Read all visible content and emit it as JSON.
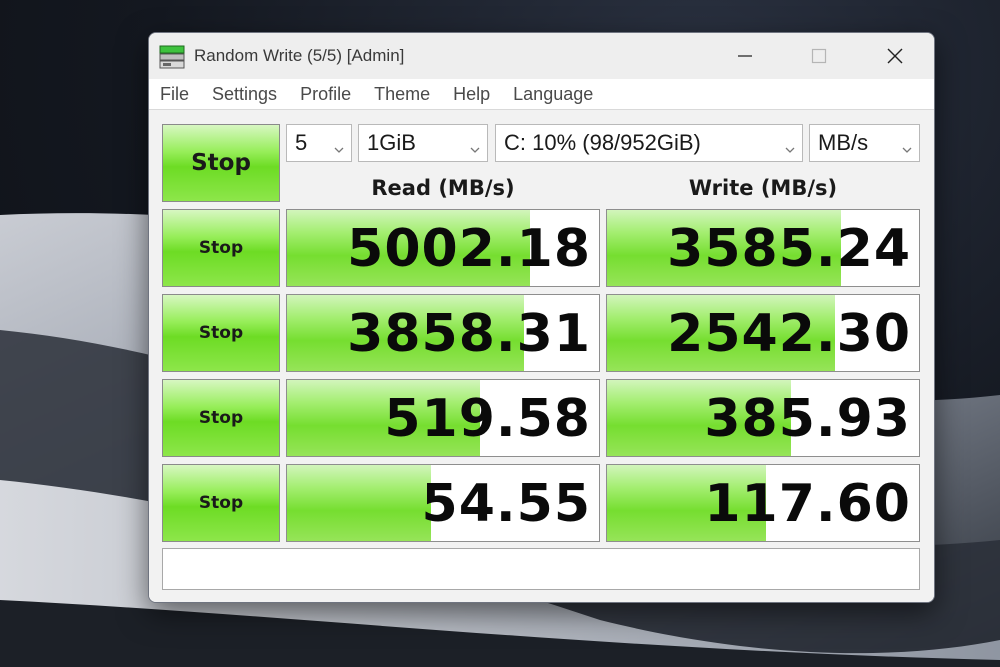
{
  "window": {
    "title": "Random Write (5/5) [Admin]"
  },
  "menu": [
    "File",
    "Settings",
    "Profile",
    "Theme",
    "Help",
    "Language"
  ],
  "controls": {
    "main_button": "Stop",
    "count": "5",
    "size": "1GiB",
    "drive": "C: 10% (98/952GiB)",
    "unit": "MB/s"
  },
  "headers": {
    "read": "Read (MB/s)",
    "write": "Write (MB/s)"
  },
  "rows": [
    {
      "button": "Stop",
      "read": "5002.18",
      "write": "3585.24",
      "read_fill": 0.78,
      "write_fill": 0.75
    },
    {
      "button": "Stop",
      "read": "3858.31",
      "write": "2542.30",
      "read_fill": 0.76,
      "write_fill": 0.73
    },
    {
      "button": "Stop",
      "read": "519.58",
      "write": "385.93",
      "read_fill": 0.62,
      "write_fill": 0.59
    },
    {
      "button": "Stop",
      "read": "54.55",
      "write": "117.60",
      "read_fill": 0.46,
      "write_fill": 0.51
    }
  ],
  "status": "",
  "colors": {
    "accent_green": "#6ddc24",
    "window_bg": "#f2f2f2"
  },
  "icons": {
    "app": "disk-drive-icon",
    "minimize": "minimize-icon",
    "maximize": "maximize-icon",
    "close": "close-icon"
  }
}
